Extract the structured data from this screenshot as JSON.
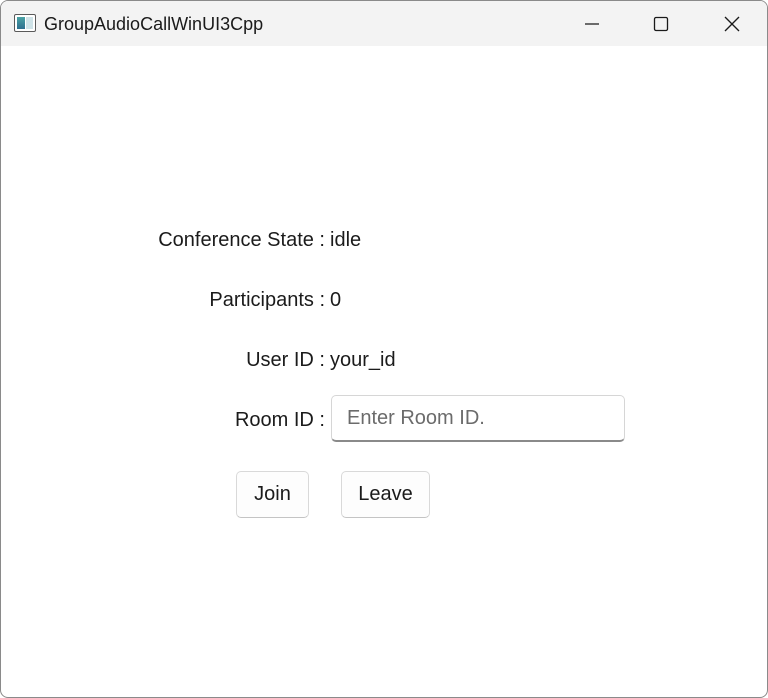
{
  "window": {
    "title": "GroupAudioCallWinUI3Cpp",
    "icon": "app-window-icon",
    "controls": {
      "minimize_icon": "minimize-icon",
      "maximize_icon": "maximize-icon",
      "close_icon": "close-icon"
    }
  },
  "conference": {
    "state_label": "Conference State :",
    "state_value": "idle",
    "participants_label": "Participants :",
    "participants_value": "0",
    "user_id_label": "User ID :",
    "user_id_value": "your_id",
    "room_id_label": "Room ID :",
    "room_id_value": "",
    "room_id_placeholder": "Enter Room ID."
  },
  "actions": {
    "join_label": "Join",
    "leave_label": "Leave"
  },
  "colors": {
    "titlebar_bg": "#f3f3f3",
    "window_bg": "#ffffff",
    "text": "#1b1b1b",
    "placeholder": "#6b6b6b",
    "input_underline": "#8a8a8a"
  }
}
